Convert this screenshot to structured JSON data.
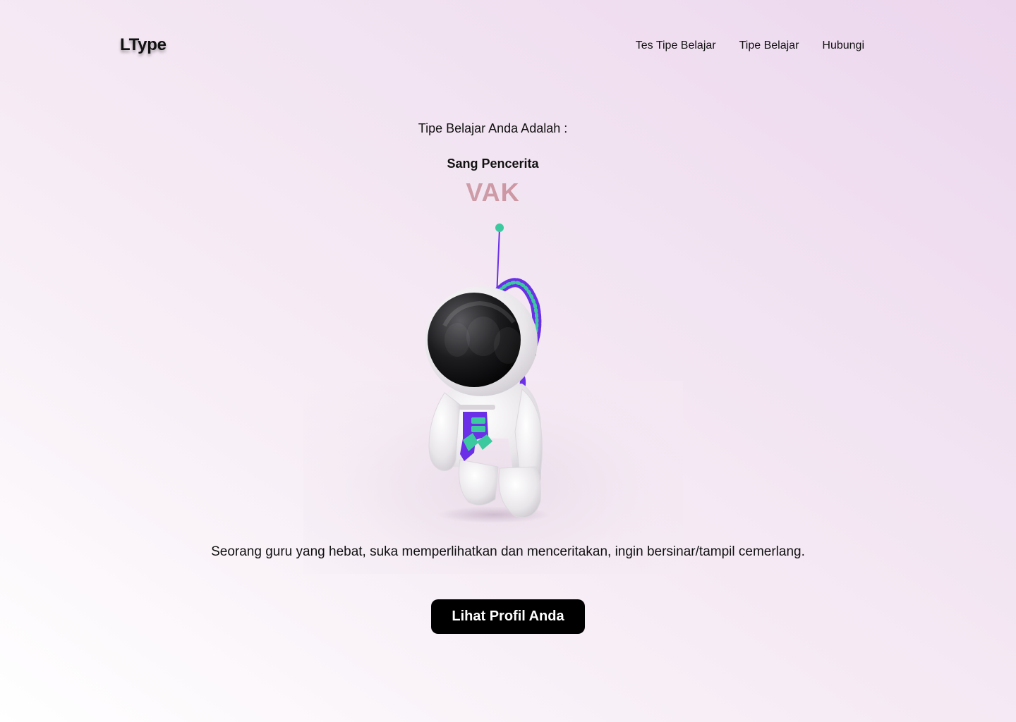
{
  "brand": {
    "logo_text": "LType"
  },
  "nav": {
    "items": [
      {
        "label": "Tes Tipe Belajar"
      },
      {
        "label": "Tipe Belajar"
      },
      {
        "label": "Hubungi"
      }
    ]
  },
  "result": {
    "label": "Tipe Belajar Anda Adalah :",
    "name": "Sang Pencerita",
    "code": "VAK",
    "description": "Seorang guru yang hebat, suka memperlihatkan dan menceritakan, ingin bersinar/tampil cemerlang."
  },
  "illustration": {
    "icon": "astronaut-illustration"
  },
  "cta": {
    "label": "Lihat Profil Anda"
  },
  "colors": {
    "accent_teal": "#3cc9a0",
    "accent_purple": "#6a2fe6",
    "code_gradient_start": "#d9d2d6",
    "code_gradient_end": "#c25b70",
    "button_bg": "#000000"
  }
}
